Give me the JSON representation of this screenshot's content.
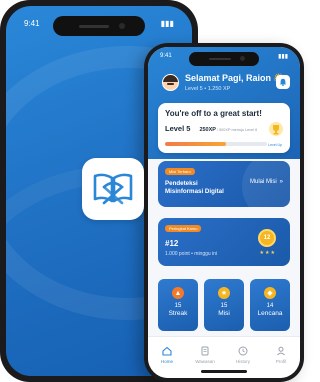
{
  "back_phone": {
    "status_time": "9:41",
    "status_icons": "▮▮▮"
  },
  "front_phone": {
    "status_time": "9:41",
    "status_icons": "▮▮▮",
    "header": {
      "greeting": "Selamat Pagi, Raion",
      "wave": "👋",
      "level_text": "Level 5  •  1.250 XP"
    },
    "progress_card": {
      "title": "You're off to a great start!",
      "level": "Level 5",
      "xp": "250XP",
      "xp_target": "/ 500XP menuju Level 6",
      "badge": "Level Up",
      "progress": 0.6
    },
    "mission_card": {
      "tag": "Misi Terbaru",
      "title": "Pendeteksi Misinformasi Digital",
      "button": "Mulai Misi",
      "chevron": "»"
    },
    "rank_card": {
      "tag": "Peringkat Kamu",
      "rank": "#12",
      "points": "1.000 point  •  minggu ini",
      "medal": "12",
      "stars": "★★★"
    },
    "stats": [
      {
        "number": "15",
        "label": "Streak",
        "color": "#f5792a",
        "glyph": "▲"
      },
      {
        "number": "15",
        "label": "Misi",
        "color": "#f5b621",
        "glyph": "★"
      },
      {
        "number": "14",
        "label": "Lencana",
        "color": "#f5b621",
        "glyph": "◆"
      }
    ],
    "nav": [
      {
        "label": "Home",
        "icon": "home-icon",
        "active": true
      },
      {
        "label": "Wawasan",
        "icon": "book-icon",
        "active": false
      },
      {
        "label": "History",
        "icon": "clock-icon",
        "active": false
      },
      {
        "label": "Profil",
        "icon": "user-icon",
        "active": false
      }
    ],
    "colors": {
      "primary": "#2a86d6",
      "accent": "#f08a24",
      "gold": "#f5b621"
    }
  }
}
